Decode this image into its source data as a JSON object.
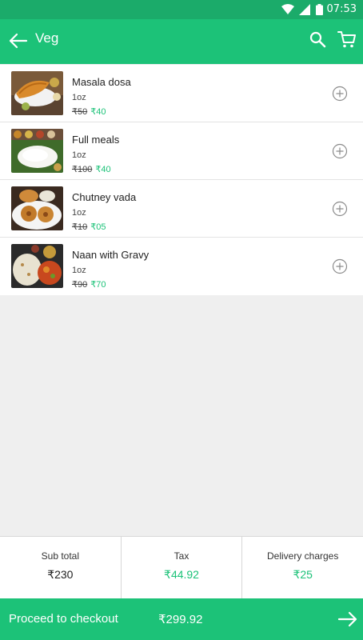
{
  "status_bar": {
    "time": "07:53",
    "icons": [
      "wifi-icon",
      "signal-icon",
      "battery-icon"
    ]
  },
  "app_bar": {
    "title": "Veg",
    "icons": [
      "back-arrow-icon",
      "search-icon",
      "cart-icon"
    ]
  },
  "items": [
    {
      "name": "Masala dosa",
      "qty": "1oz",
      "old_price": "₹50",
      "new_price": "₹40"
    },
    {
      "name": "Full meals",
      "qty": "1oz",
      "old_price": "₹100",
      "new_price": "₹40"
    },
    {
      "name": "Chutney vada",
      "qty": "1oz",
      "old_price": "₹10",
      "new_price": "₹05"
    },
    {
      "name": "Naan with Gravy",
      "qty": "1oz",
      "old_price": "₹90",
      "new_price": "₹70"
    }
  ],
  "summary": {
    "subtotal_label": "Sub total",
    "subtotal_value": "₹230",
    "tax_label": "Tax",
    "tax_value": "₹44.92",
    "delivery_label": "Delivery charges",
    "delivery_value": "₹25"
  },
  "checkout": {
    "label": "Proceed to checkout",
    "total": "₹299.92"
  },
  "colors": {
    "primary": "#1cc278",
    "status_bar": "#1bab6a",
    "price_green": "#1cc278"
  }
}
